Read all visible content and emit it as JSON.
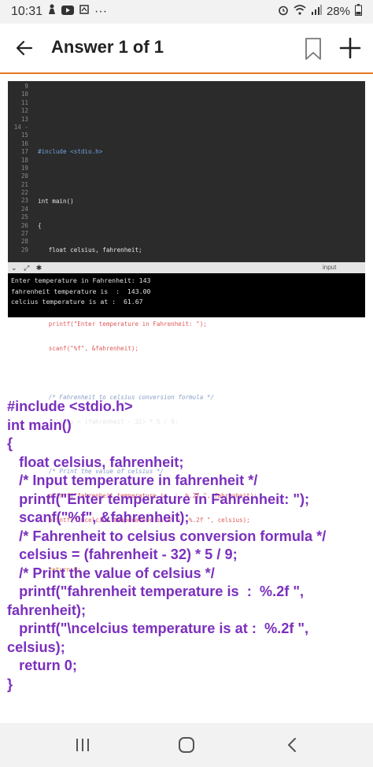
{
  "status_bar": {
    "time": "10:31",
    "more": "···",
    "battery": "28%"
  },
  "header": {
    "title": "Answer 1 of 1"
  },
  "code_editor": {
    "line_numbers": [
      "9",
      "10",
      "11",
      "12",
      "13",
      "14 -",
      "15",
      "16",
      "17",
      "18",
      "19",
      "20",
      "21",
      "22",
      "23",
      "24",
      "25",
      "26",
      "27",
      "28",
      "29"
    ],
    "input_tab_label": "input"
  },
  "console": {
    "lines": [
      "Enter temperature in Fahrenheit: 143",
      "fahrenheit temperature is  :  143.00",
      "celcius temperature is at :  61.67"
    ]
  },
  "answer": {
    "lines": [
      "#include <stdio.h>",
      "int main()",
      "{",
      "   float celsius, fahrenheit;",
      "   /* Input temperature in fahrenheit */",
      "   printf(\"Enter temperature in Fahrenheit: \");",
      "   scanf(\"%f\", &fahrenheit);",
      "   /* Fahrenheit to celsius conversion formula */",
      "   celsius = (fahrenheit - 32) * 5 / 9;",
      "   /* Print the value of celsius */",
      "   printf(\"fahrenheit temperature is  :  %.2f \", fahrenheit);",
      "   printf(\"\\ncelcius temperature is at :  %.2f \", celsius);",
      "   return 0;",
      "}"
    ]
  },
  "colors": {
    "accent": "#e87722",
    "answer_text": "#7b2fbe"
  }
}
